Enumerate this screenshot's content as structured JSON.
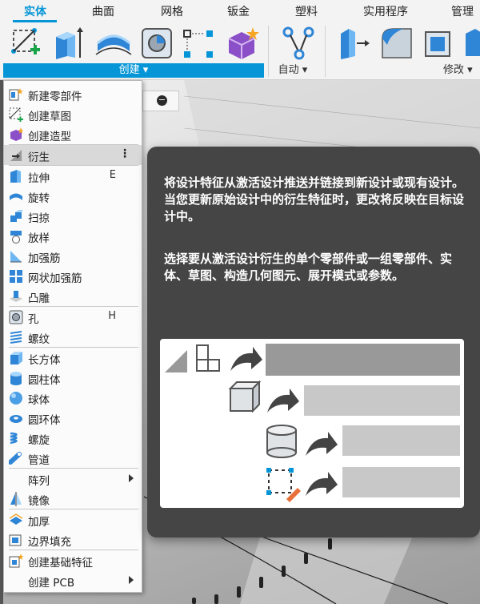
{
  "tabs": [
    {
      "label": "实体",
      "active": true
    },
    {
      "label": "曲面"
    },
    {
      "label": "网格"
    },
    {
      "label": "钣金"
    },
    {
      "label": "塑料"
    },
    {
      "label": "实用程序"
    },
    {
      "label": "管理"
    }
  ],
  "toolbar": {
    "create_label": "创建 ▾",
    "automate_label": "自动 ▾",
    "modify_label": "修改 ▾",
    "accent_color": "#0696d7"
  },
  "menu": {
    "items": [
      {
        "label": "新建零部件",
        "icon": "new-component-icon"
      },
      {
        "label": "创建草图",
        "icon": "create-sketch-icon"
      },
      {
        "label": "创建造型",
        "icon": "create-form-icon"
      },
      {
        "label": "衍生",
        "icon": "derive-icon",
        "highlighted": true,
        "more": "⋮"
      },
      {
        "label": "拉伸",
        "icon": "extrude-icon",
        "shortcut": "E"
      },
      {
        "label": "旋转",
        "icon": "revolve-icon"
      },
      {
        "label": "扫掠",
        "icon": "sweep-icon"
      },
      {
        "label": "放样",
        "icon": "loft-icon"
      },
      {
        "label": "加强筋",
        "icon": "rib-icon"
      },
      {
        "label": "网状加强筋",
        "icon": "web-icon"
      },
      {
        "label": "凸雕",
        "icon": "emboss-icon"
      },
      {
        "label": "孔",
        "icon": "hole-icon",
        "shortcut": "H"
      },
      {
        "label": "螺纹",
        "icon": "thread-icon"
      },
      {
        "label": "长方体",
        "icon": "box-icon"
      },
      {
        "label": "圆柱体",
        "icon": "cylinder-icon"
      },
      {
        "label": "球体",
        "icon": "sphere-icon"
      },
      {
        "label": "圆环体",
        "icon": "torus-icon"
      },
      {
        "label": "螺旋",
        "icon": "coil-icon"
      },
      {
        "label": "管道",
        "icon": "pipe-icon"
      },
      {
        "label": "阵列",
        "submenu": true
      },
      {
        "label": "镜像",
        "icon": "mirror-icon"
      },
      {
        "label": "加厚",
        "icon": "thicken-icon"
      },
      {
        "label": "边界填充",
        "icon": "boundary-fill-icon"
      },
      {
        "label": "创建基础特征",
        "icon": "base-feature-icon"
      },
      {
        "label": "创建 PCB",
        "submenu": true
      }
    ]
  },
  "tooltip": {
    "para1": "将设计特征从激活设计推送并链接到新设计或现有设计。当您更新原始设计中的衍生特征时，更改将反映在目标设计中。",
    "para2": "选择要从激活设计衍生的单个零部件或一组零部件、实体、草图、构造几何图元、展开模式或参数。"
  }
}
